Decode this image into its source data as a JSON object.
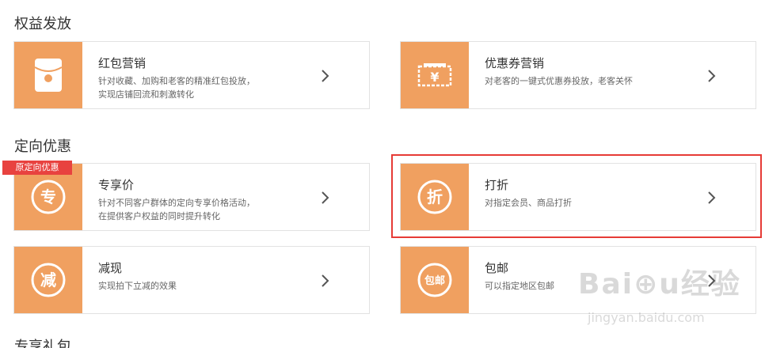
{
  "sections": [
    {
      "title": "权益发放"
    },
    {
      "title": "定向优惠"
    },
    {
      "title": "专享礼包"
    }
  ],
  "cards": {
    "red_packet": {
      "title": "红包营销",
      "desc_line1": "针对收藏、加购和老客的精准红包投放，",
      "desc_line2": "实现店铺回流和刺激转化",
      "icon": "red-envelope-icon"
    },
    "coupon": {
      "title": "优惠券营销",
      "desc_line1": "对老客的一键式优惠券投放，老客关怀",
      "icon": "yen-ticket-icon"
    },
    "exclusive_price": {
      "title": "专享价",
      "desc_line1": "针对不同客户群体的定向专享价格活动，",
      "desc_line2": "在提供客户权益的同时提升转化",
      "icon_char": "专"
    },
    "discount": {
      "title": "打折",
      "desc_line1": "对指定会员、商品打折",
      "icon_char": "折"
    },
    "cashback": {
      "title": "减现",
      "desc_line1": "实现拍下立减的效果",
      "icon_char": "减"
    },
    "free_shipping": {
      "title": "包邮",
      "desc_line1": "可以指定地区包邮",
      "icon_char": "包邮"
    }
  },
  "badge": {
    "label": "原定向优惠"
  },
  "watermark": {
    "logo": "Bai⊕u经验",
    "url": "jingyan.baidu.com"
  },
  "colors": {
    "accent": "#f0a060",
    "badge": "#e8423f",
    "highlight": "#e63b36"
  }
}
